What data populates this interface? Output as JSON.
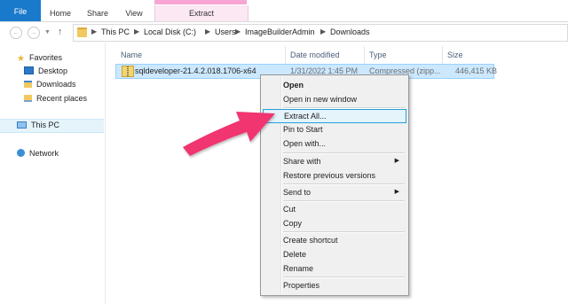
{
  "ribbon": {
    "tabs": [
      {
        "label": "File"
      },
      {
        "label": "Home"
      },
      {
        "label": "Share"
      },
      {
        "label": "View"
      },
      {
        "label": "Extract"
      }
    ]
  },
  "address": {
    "crumbs": [
      "This PC",
      "Local Disk (C:)",
      "Users",
      "ImageBuilderAdmin",
      "Downloads"
    ]
  },
  "nav": {
    "favorites": "Favorites",
    "desktop": "Desktop",
    "downloads": "Downloads",
    "recent": "Recent places",
    "this_pc": "This PC",
    "network": "Network"
  },
  "columns": {
    "name": "Name",
    "date": "Date modified",
    "type": "Type",
    "size": "Size"
  },
  "file": {
    "name": "sqldeveloper-21.4.2.018.1706-x64",
    "date": "1/31/2022 1:45 PM",
    "type": "Compressed (zipp...",
    "size": "446,415 KB"
  },
  "context_menu": {
    "items": [
      {
        "label": "Open"
      },
      {
        "label": "Open in new window"
      },
      {
        "label": "Extract All..."
      },
      {
        "label": "Pin to Start"
      },
      {
        "label": "Open with..."
      },
      {
        "label": "Share with"
      },
      {
        "label": "Restore previous versions"
      },
      {
        "label": "Send to"
      },
      {
        "label": "Cut"
      },
      {
        "label": "Copy"
      },
      {
        "label": "Create shortcut"
      },
      {
        "label": "Delete"
      },
      {
        "label": "Rename"
      },
      {
        "label": "Properties"
      }
    ]
  },
  "colors": {
    "file_tab": "#1979ca",
    "extract_tab": "#f7a6d3",
    "selection": "#cce8ff",
    "menu_highlight": "#26a0da",
    "annotation_arrow": "#f0346f"
  }
}
